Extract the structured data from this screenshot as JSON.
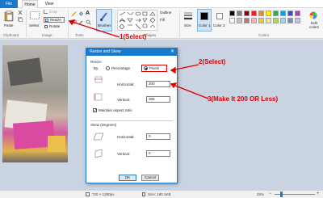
{
  "tabs": {
    "file": "File",
    "home": "Home",
    "view": "View"
  },
  "ribbon": {
    "paste": "Paste",
    "select": "Select",
    "crop": "Crop",
    "resize": "Resize",
    "rotate": "Rotate",
    "brushes": "Brushes",
    "outline": "Outline",
    "fill": "Fill",
    "size": "Size",
    "color1": "Color 1",
    "color2": "Color 2",
    "edit_colors": "Edit colors",
    "groups": {
      "clipboard": "Clipboard",
      "image": "Image",
      "tools": "Tools",
      "shapes": "Shapes",
      "colors": "Colors"
    },
    "palette": [
      "#000000",
      "#7f7f7f",
      "#880015",
      "#ed1c24",
      "#ff7f27",
      "#fff200",
      "#22b14c",
      "#00a2e8",
      "#3f48cc",
      "#a349a4",
      "#ffffff",
      "#c3c3c3",
      "#b97a57",
      "#ffaec9",
      "#ffc90e",
      "#efe4b0",
      "#b5e61d",
      "#99d9ea",
      "#7092be",
      "#c8bfe7"
    ]
  },
  "dialog": {
    "title": "Resize and Skew",
    "resize_section": "Resize",
    "by": "By:",
    "percentage": "Percentage",
    "pixels": "Pixels",
    "horizontal_label": "Horizontal:",
    "horizontal_value": "200",
    "vertical_label": "Vertical:",
    "vertical_value": "355",
    "maintain_aspect": "Maintain aspect ratio",
    "skew_section": "Skew (Degrees)",
    "skew_horizontal_label": "Horizontal:",
    "skew_horizontal_value": "0",
    "skew_vertical_label": "Vertical:",
    "skew_vertical_value": "0",
    "ok": "OK",
    "cancel": "Cancel"
  },
  "status": {
    "dimensions": "720 × 1280px",
    "size": "Size: 180.1KB",
    "zoom": "25%"
  },
  "annotations": {
    "a1": "1(Select)",
    "a2": "2(Select)",
    "a3": "3(Make It 200 OR Less)"
  },
  "colors": {
    "accent": "#1979ca",
    "annotation": "#e00000"
  }
}
